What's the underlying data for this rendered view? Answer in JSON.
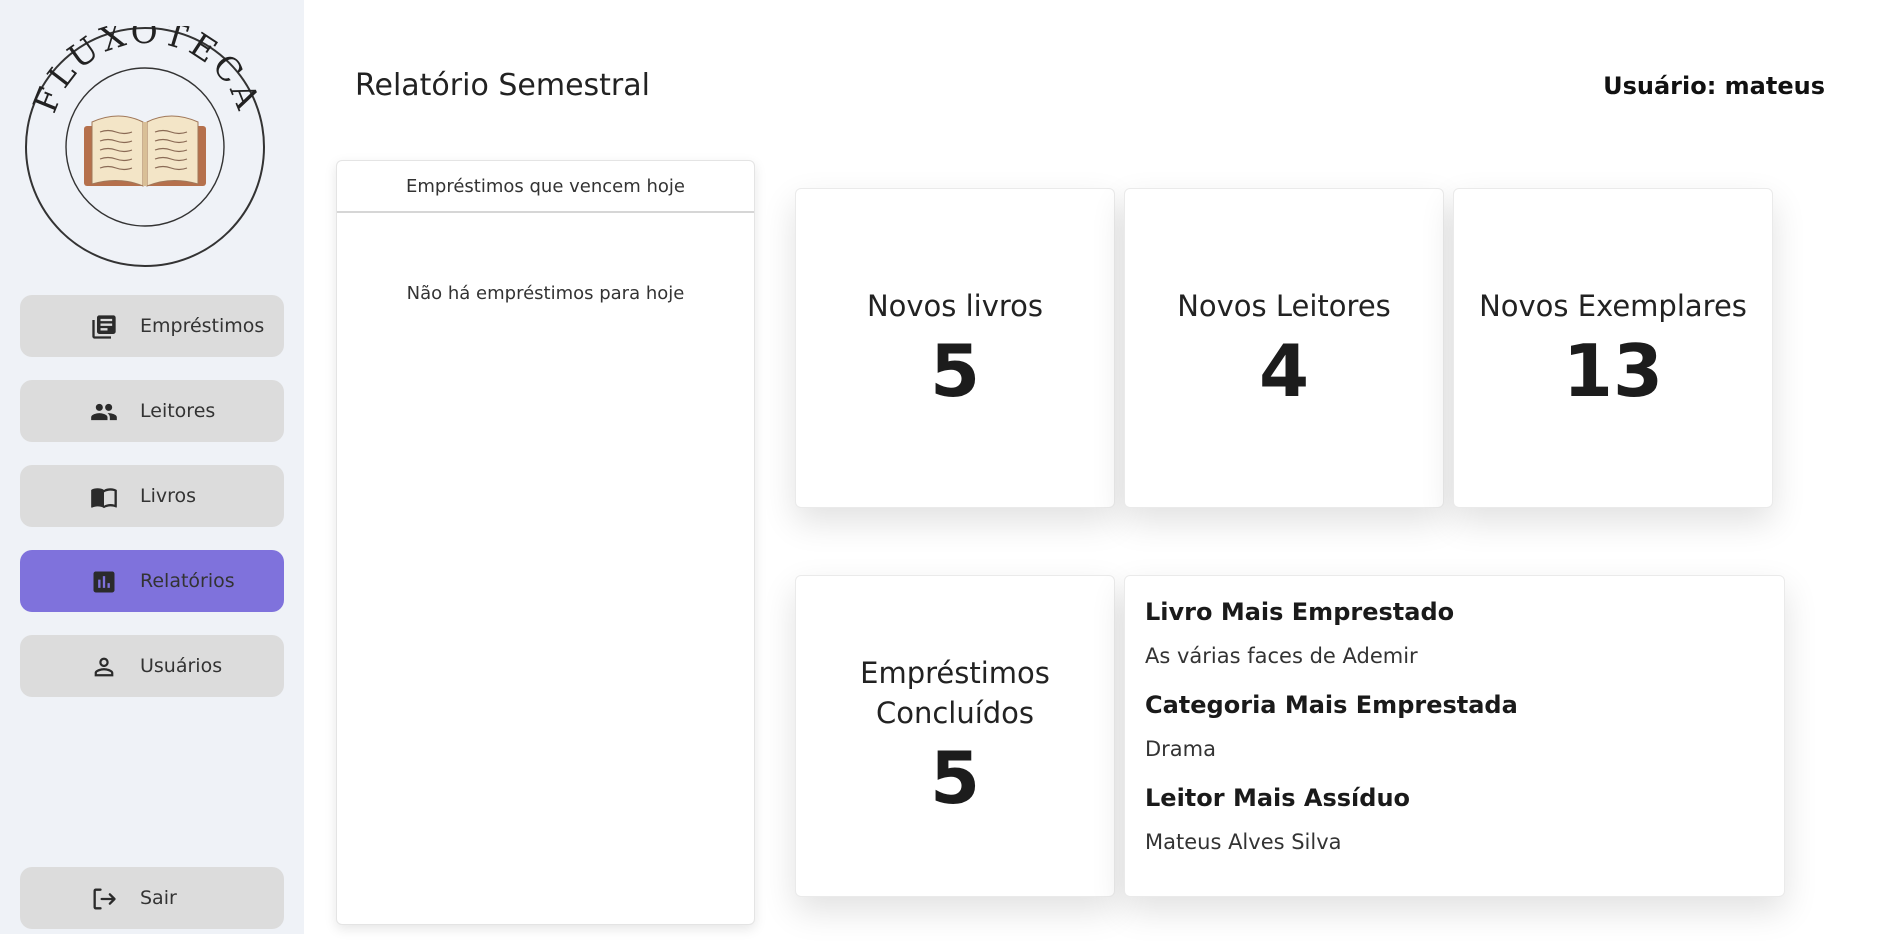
{
  "app": {
    "logo_text": "FLUXOTECA"
  },
  "sidebar": {
    "items": [
      {
        "label": "Empréstimos",
        "icon": "loans-icon"
      },
      {
        "label": "Leitores",
        "icon": "readers-icon"
      },
      {
        "label": "Livros",
        "icon": "books-icon"
      },
      {
        "label": "Relatórios",
        "icon": "reports-icon"
      },
      {
        "label": "Usuários",
        "icon": "user-icon"
      }
    ],
    "active_item": "Relatórios",
    "logout_label": "Sair"
  },
  "header": {
    "title": "Relatório Semestral",
    "user_text": "Usuário: mateus"
  },
  "loans_today": {
    "title": "Empréstimos que vencem hoje",
    "empty_message": "Não há empréstimos para hoje"
  },
  "cards": {
    "new_books": {
      "title": "Novos livros",
      "value": "5"
    },
    "new_readers": {
      "title": "Novos Leitores",
      "value": "4"
    },
    "new_copies": {
      "title": "Novos Exemplares",
      "value": "13"
    },
    "completed_loans": {
      "title_line1": "Empréstimos",
      "title_line2": "Concluídos",
      "value": "5"
    }
  },
  "stats": {
    "most_borrowed_book_label": "Livro Mais Emprestado",
    "most_borrowed_book_value": "As várias faces de Ademir",
    "most_borrowed_category_label": "Categoria Mais Emprestada",
    "most_borrowed_category_value": "Drama",
    "most_assiduous_reader_label": "Leitor Mais Assíduo",
    "most_assiduous_reader_value": "Mateus Alves Silva"
  },
  "colors": {
    "sidebar_bg": "#eff2f7",
    "nav_button_bg": "#dcdcdc",
    "nav_active_bg": "#7f72dc"
  }
}
